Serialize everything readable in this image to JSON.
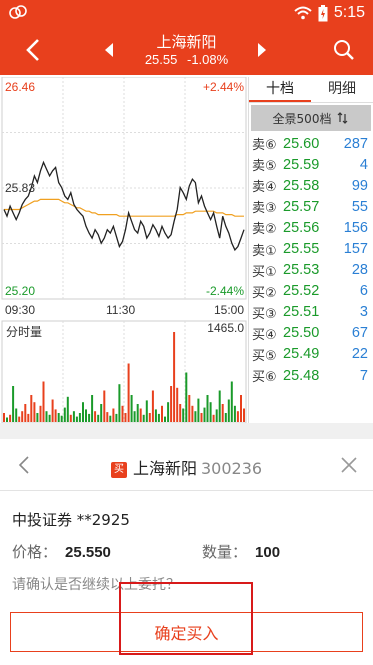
{
  "status_bar": {
    "time": "5:15",
    "icons": [
      "app-logo-icon",
      "wifi-icon",
      "battery-icon"
    ]
  },
  "nav": {
    "title": "上海新阳",
    "price": "25.55",
    "change_pct": "-1.08%"
  },
  "chart": {
    "high_price": "26.46",
    "high_pct": "+2.44%",
    "mid_price": "25.83",
    "low_price": "25.20",
    "low_pct": "-2.44%",
    "time_start": "09:30",
    "time_mid": "11:30",
    "time_end": "15:00",
    "volume_title": "分时量",
    "volume_max": "1465.0"
  },
  "chart_data": {
    "type": "line",
    "title": "",
    "ylim": [
      25.2,
      26.46
    ],
    "series": [
      {
        "values": [
          25.72,
          25.68,
          25.74,
          25.7,
          25.66,
          25.7,
          25.75,
          25.78,
          25.8,
          25.85,
          25.92,
          25.88,
          25.95,
          26.0,
          25.96,
          25.92,
          25.95,
          25.97,
          25.88,
          25.85,
          25.8,
          25.78,
          25.82,
          25.75,
          25.72,
          25.7,
          25.68,
          25.62,
          25.58,
          25.55,
          25.6,
          25.57,
          25.52,
          25.55,
          25.6,
          25.58,
          25.62,
          25.56,
          25.5,
          25.53,
          25.6,
          25.7,
          25.65,
          25.6,
          25.58,
          25.65,
          25.62,
          25.55,
          25.58,
          25.63,
          25.6,
          25.56,
          25.62,
          25.58,
          25.55,
          25.57,
          25.65,
          25.72,
          25.85,
          25.82,
          25.78,
          25.86,
          25.9,
          25.88,
          25.76,
          25.8,
          25.74,
          25.7,
          25.66,
          25.7,
          25.62,
          25.55,
          25.68,
          25.62,
          25.58,
          25.52,
          25.48,
          25.5,
          25.55,
          25.6
        ]
      },
      {
        "values": [
          25.72,
          25.72,
          25.72,
          25.72,
          25.72,
          25.72,
          25.73,
          25.74,
          25.75,
          25.76,
          25.77,
          25.77,
          25.78,
          25.78,
          25.78,
          25.78,
          25.78,
          25.78,
          25.78,
          25.77,
          25.76,
          25.76,
          25.75,
          25.74,
          25.73,
          25.73,
          25.72,
          25.71,
          25.71,
          25.7,
          25.7,
          25.69,
          25.69,
          25.69,
          25.69,
          25.69,
          25.69,
          25.69,
          25.68,
          25.68,
          25.68,
          25.68,
          25.68,
          25.68,
          25.68,
          25.68,
          25.68,
          25.68,
          25.68,
          25.68,
          25.68,
          25.68,
          25.68,
          25.68,
          25.68,
          25.68,
          25.68,
          25.69,
          25.69,
          25.69,
          25.7,
          25.7,
          25.7,
          25.71,
          25.71,
          25.71,
          25.71,
          25.71,
          25.71,
          25.71,
          25.7,
          25.7,
          25.7,
          25.69,
          25.69,
          25.69,
          25.68,
          25.68,
          25.68,
          25.68
        ]
      }
    ],
    "volume": [
      0.1,
      0.05,
      0.08,
      0.4,
      0.15,
      0.06,
      0.12,
      0.2,
      0.09,
      0.3,
      0.22,
      0.1,
      0.18,
      0.45,
      0.12,
      0.08,
      0.25,
      0.14,
      0.1,
      0.07,
      0.16,
      0.28,
      0.08,
      0.12,
      0.06,
      0.1,
      0.22,
      0.14,
      0.09,
      0.3,
      0.12,
      0.08,
      0.2,
      0.35,
      0.11,
      0.07,
      0.15,
      0.09,
      0.42,
      0.18,
      0.1,
      0.65,
      0.3,
      0.12,
      0.2,
      0.15,
      0.08,
      0.24,
      0.1,
      0.35,
      0.14,
      0.09,
      0.18,
      0.06,
      0.22,
      0.4,
      1.0,
      0.38,
      0.2,
      0.15,
      0.55,
      0.3,
      0.18,
      0.12,
      0.26,
      0.1,
      0.16,
      0.3,
      0.22,
      0.08,
      0.14,
      0.35,
      0.2,
      0.1,
      0.25,
      0.45,
      0.18,
      0.12,
      0.3,
      0.15
    ]
  },
  "book": {
    "tabs": [
      "十档",
      "明细"
    ],
    "full_button": "全景500档",
    "rows": [
      {
        "side": "卖⑥",
        "price": "25.60",
        "vol": "287"
      },
      {
        "side": "卖⑤",
        "price": "25.59",
        "vol": "4"
      },
      {
        "side": "卖④",
        "price": "25.58",
        "vol": "99"
      },
      {
        "side": "卖③",
        "price": "25.57",
        "vol": "55"
      },
      {
        "side": "卖②",
        "price": "25.56",
        "vol": "156"
      },
      {
        "side": "卖①",
        "price": "25.55",
        "vol": "157"
      },
      {
        "side": "买①",
        "price": "25.53",
        "vol": "28"
      },
      {
        "side": "买②",
        "price": "25.52",
        "vol": "6"
      },
      {
        "side": "买③",
        "price": "25.51",
        "vol": "3"
      },
      {
        "side": "买④",
        "price": "25.50",
        "vol": "67"
      },
      {
        "side": "买⑤",
        "price": "25.49",
        "vol": "22"
      },
      {
        "side": "买⑥",
        "price": "25.48",
        "vol": "7"
      }
    ]
  },
  "dialog": {
    "badge": "买",
    "stock_name": "上海新阳",
    "stock_code": "300236",
    "account": "中投证券 **2925",
    "price_label": "价格：",
    "price_value": "25.550",
    "qty_label": "数量：",
    "qty_value": "100",
    "question": "请确认是否继续以上委托？",
    "confirm_label": "确定买入"
  },
  "colors": {
    "accent": "#e8401d",
    "up": "#e8401d",
    "down": "#1a9a2a",
    "avg_line": "#f0a020",
    "volume_blue": "#2a7fd4"
  }
}
